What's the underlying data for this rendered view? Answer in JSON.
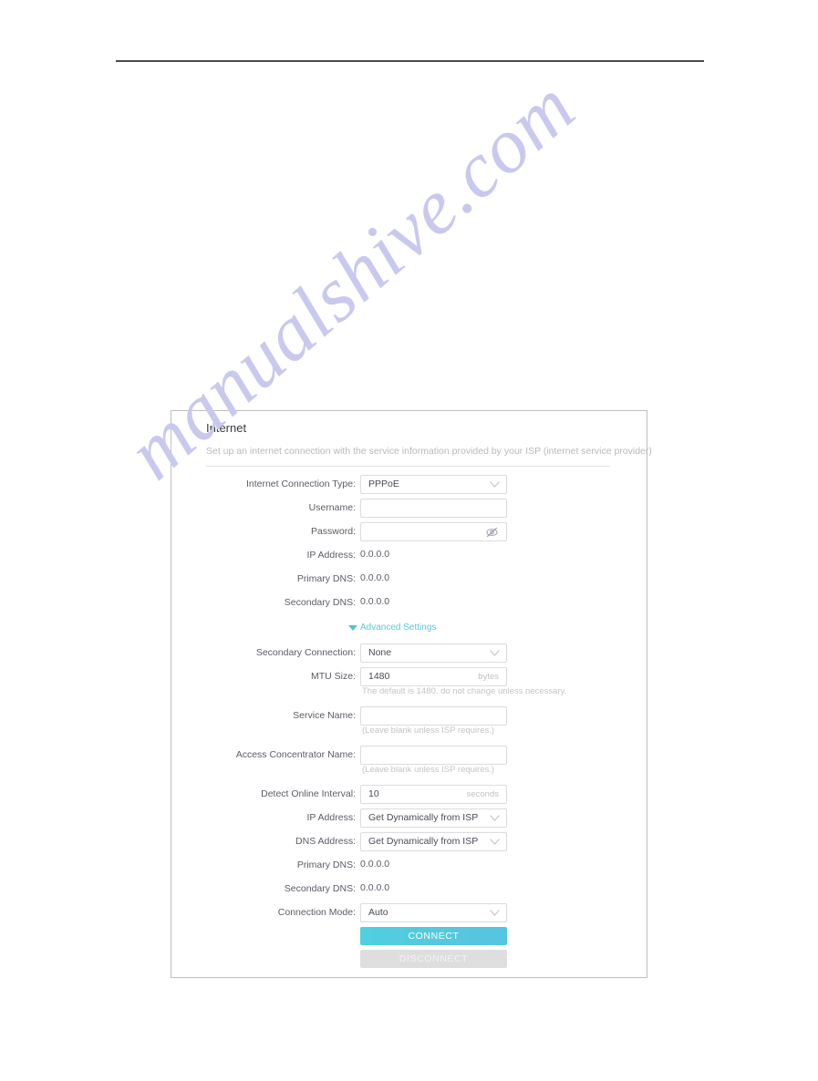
{
  "watermark": {
    "text": "manualshive.com"
  },
  "card": {
    "title": "Internet",
    "subtitle": "Set up an internet connection with the service information provided by your ISP (internet service provider)",
    "advanced_settings_label": "Advanced Settings",
    "fields": {
      "internet_connection_type": {
        "label": "Internet Connection Type:",
        "value": "PPPoE",
        "type": "select"
      },
      "username": {
        "label": "Username:",
        "value": "",
        "placeholder": "",
        "type": "text"
      },
      "password": {
        "label": "Password:",
        "value": "",
        "placeholder": "",
        "type": "password"
      },
      "ip_address_status": {
        "label": "IP Address:",
        "value": "0.0.0.0",
        "type": "static"
      },
      "primary_dns_status": {
        "label": "Primary DNS:",
        "value": "0.0.0.0",
        "type": "static"
      },
      "secondary_dns_status": {
        "label": "Secondary DNS:",
        "value": "0.0.0.0",
        "type": "static"
      },
      "secondary_connection": {
        "label": "Secondary Connection:",
        "value": "None",
        "type": "select"
      },
      "mtu_size": {
        "label": "MTU Size:",
        "value": "1480",
        "unit": "bytes",
        "hint": "The default is 1480, do not change unless necessary.",
        "type": "text"
      },
      "service_name": {
        "label": "Service Name:",
        "value": "",
        "hint": "(Leave blank unless ISP requires.)",
        "type": "text"
      },
      "access_concentrator_name": {
        "label": "Access Concentrator Name:",
        "value": "",
        "hint": "(Leave blank unless ISP requires.)",
        "type": "text"
      },
      "detect_online_interval": {
        "label": "Detect Online Interval:",
        "value": "10",
        "unit": "seconds",
        "type": "text"
      },
      "ip_address_mode": {
        "label": "IP Address:",
        "value": "Get Dynamically from ISP",
        "type": "select"
      },
      "dns_address_mode": {
        "label": "DNS Address:",
        "value": "Get Dynamically from ISP",
        "type": "select"
      },
      "primary_dns_adv": {
        "label": "Primary DNS:",
        "value": "0.0.0.0",
        "type": "static"
      },
      "secondary_dns_adv": {
        "label": "Secondary DNS:",
        "value": "0.0.0.0",
        "type": "static"
      },
      "connection_mode": {
        "label": "Connection Mode:",
        "value": "Auto",
        "type": "select"
      }
    },
    "buttons": {
      "connect": "CONNECT",
      "disconnect": "DISCONNECT"
    }
  },
  "colors": {
    "accent": "#4fc3d4",
    "connect_button": "#53c8de",
    "disconnect_button": "#dedede",
    "watermark": "#c9c9ef",
    "label_text": "#5b5b66",
    "hint_text": "#c4c4c4"
  }
}
